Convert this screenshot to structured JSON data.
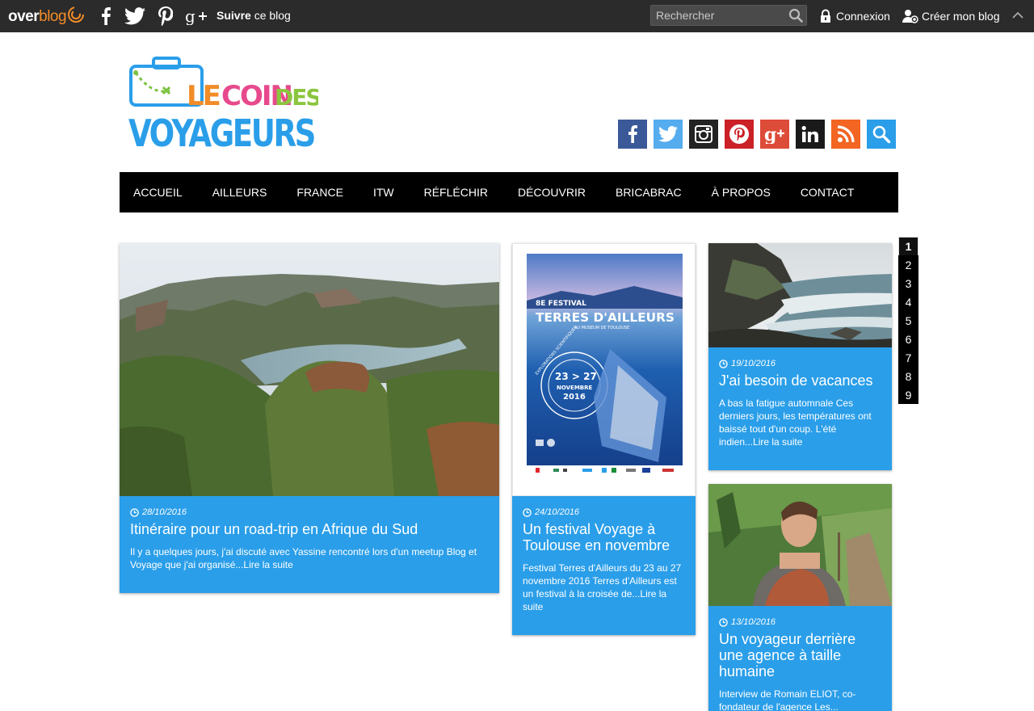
{
  "topbar": {
    "brand_bold": "over",
    "brand_rest": "blog",
    "follow_bold": "Suivre",
    "follow_rest": " ce blog",
    "search_placeholder": "Rechercher",
    "login_label": "Connexion",
    "create_label": "Créer mon blog",
    "icons": [
      "facebook-icon",
      "twitter-icon",
      "pinterest-icon",
      "google-plus-icon",
      "search-icon",
      "lock-icon",
      "user-add-icon",
      "chevron-up-icon"
    ]
  },
  "header": {
    "logo_line1_a": "LE",
    "logo_line1_b": "COIN",
    "logo_line1_c": "DES",
    "logo_line2": "VOYAGEURS",
    "social": [
      {
        "name": "facebook",
        "color": "#3b5998"
      },
      {
        "name": "twitter",
        "color": "#55acee"
      },
      {
        "name": "instagram",
        "color": "#222222"
      },
      {
        "name": "pinterest",
        "color": "#cb2027"
      },
      {
        "name": "google-plus",
        "color": "#dd4b39"
      },
      {
        "name": "linkedin",
        "color": "#1a1a1a"
      },
      {
        "name": "rss",
        "color": "#f26522"
      },
      {
        "name": "search",
        "color": "#2a9ee9"
      }
    ]
  },
  "nav": {
    "items": [
      "ACCUEIL",
      "AILLEURS",
      "FRANCE",
      "ITW",
      "RÉFLÉCHIR",
      "DÉCOUVRIR",
      "BRICABRAC",
      "À PROPOS",
      "CONTACT"
    ]
  },
  "poster": {
    "edition": "8E FESTIVAL",
    "name": "TERRES D'AILLEURS",
    "venue": "AU MUSEUM DE TOULOUSE",
    "dates": "23 > 27",
    "month": "NOVEMBRE",
    "year": "2016",
    "ring": "EXPLORATIONS SCIENTIFIQUES"
  },
  "posts": [
    {
      "date": "28/10/2016",
      "title": "Itinéraire pour un road-trip en Afrique du Sud",
      "excerpt": "Il y a quelques jours, j'ai discuté avec Yassine rencontré lors d'un meetup Blog et Voyage que j'ai organisé...Lire la suite"
    },
    {
      "date": "24/10/2016",
      "title": "Un festival Voyage à Toulouse en novembre",
      "excerpt": "Festival Terres d'Ailleurs du 23 au 27 novembre 2016 Terres d'Ailleurs est un festival à la croisée de...Lire la suite"
    },
    {
      "date": "19/10/2016",
      "title": "J'ai besoin de vacances",
      "excerpt": "A bas la fatigue automnale Ces derniers jours, les températures ont baissé tout d'un coup. L'été indien...Lire la suite"
    },
    {
      "date": "13/10/2016",
      "title": "Un voyageur derrière une agence à taille humaine",
      "excerpt": "Interview de Romain ELIOT, co-fondateur de l'agence Les..."
    }
  ],
  "pager": {
    "pages": [
      "1",
      "2",
      "3",
      "4",
      "5",
      "6",
      "7",
      "8",
      "9"
    ],
    "current": "1"
  }
}
